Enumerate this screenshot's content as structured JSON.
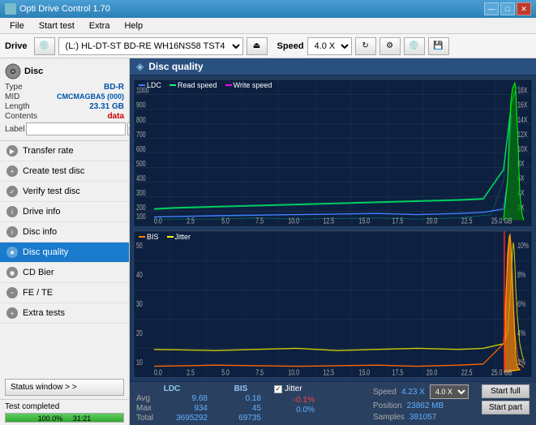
{
  "titleBar": {
    "title": "Opti Drive Control 1.70",
    "minimizeBtn": "—",
    "maximizeBtn": "□",
    "closeBtn": "✕"
  },
  "menuBar": {
    "items": [
      "File",
      "Start test",
      "Extra",
      "Help"
    ]
  },
  "driveToolbar": {
    "driveLabel": "Drive",
    "driveValue": "(L:)  HL-DT-ST BD-RE  WH16NS58 TST4",
    "speedLabel": "Speed",
    "speedValue": "4.0 X"
  },
  "sidebar": {
    "discSection": {
      "title": "Disc",
      "typeLabel": "Type",
      "typeValue": "BD-R",
      "midLabel": "MID",
      "midValue": "CMCMAGBA5 (000)",
      "lengthLabel": "Length",
      "lengthValue": "23.31 GB",
      "contentsLabel": "Contents",
      "contentsValue": "data",
      "labelLabel": "Label",
      "labelPlaceholder": ""
    },
    "navItems": [
      {
        "id": "transfer-rate",
        "label": "Transfer rate"
      },
      {
        "id": "create-test-disc",
        "label": "Create test disc"
      },
      {
        "id": "verify-test-disc",
        "label": "Verify test disc"
      },
      {
        "id": "drive-info",
        "label": "Drive info"
      },
      {
        "id": "disc-info",
        "label": "Disc info"
      },
      {
        "id": "disc-quality",
        "label": "Disc quality",
        "active": true
      },
      {
        "id": "cd-bier",
        "label": "CD Bier"
      },
      {
        "id": "fe-te",
        "label": "FE / TE"
      },
      {
        "id": "extra-tests",
        "label": "Extra tests"
      }
    ],
    "statusWindowBtn": "Status window > >",
    "statusText": "Test completed",
    "progressValue": "100.0%",
    "timeValue": "31:21"
  },
  "contentArea": {
    "title": "Disc quality",
    "chart1": {
      "legend": [
        {
          "label": "LDC",
          "color": "#4080ff"
        },
        {
          "label": "Read speed",
          "color": "#00ff80"
        },
        {
          "label": "Write speed",
          "color": "#ff00ff"
        }
      ],
      "yAxisMax": 1000,
      "yLabels": [
        "1000",
        "900",
        "800",
        "700",
        "600",
        "500",
        "400",
        "300",
        "200",
        "100"
      ],
      "yRight": [
        "18X",
        "16X",
        "14X",
        "12X",
        "10X",
        "8X",
        "6X",
        "4X",
        "2X"
      ],
      "xLabels": [
        "0.0",
        "2.5",
        "5.0",
        "7.5",
        "10.0",
        "12.5",
        "15.0",
        "17.5",
        "20.0",
        "22.5",
        "25.0 GB"
      ]
    },
    "chart2": {
      "legend": [
        {
          "label": "BIS",
          "color": "#ff8000"
        },
        {
          "label": "Jitter",
          "color": "#ffff00"
        }
      ],
      "yAxisMax": 50,
      "yLabels": [
        "50",
        "40",
        "30",
        "20",
        "10"
      ],
      "yRight": [
        "10%",
        "8%",
        "6%",
        "4%",
        "2%"
      ],
      "xLabels": [
        "0.0",
        "2.5",
        "5.0",
        "7.5",
        "10.0",
        "12.5",
        "15.0",
        "17.5",
        "20.0",
        "22.5",
        "25.0 GB"
      ]
    },
    "statsBar": {
      "columns": [
        {
          "header": "LDC",
          "rows": [
            {
              "label": "Avg",
              "value": "9.68"
            },
            {
              "label": "Max",
              "value": "934"
            },
            {
              "label": "Total",
              "value": "3695292"
            }
          ]
        },
        {
          "header": "BIS",
          "rows": [
            {
              "label": "",
              "value": "0.18"
            },
            {
              "label": "",
              "value": "45"
            },
            {
              "label": "",
              "value": "69735"
            }
          ]
        }
      ],
      "jitterLabel": "Jitter",
      "jitterRows": [
        {
          "label": "",
          "value": "-0.1%"
        },
        {
          "label": "",
          "value": "0.0%"
        }
      ],
      "speedLabel": "Speed",
      "speedValue": "4.23 X",
      "speedSelect": "4.0 X",
      "positionLabel": "Position",
      "positionValue": "23862 MB",
      "samplesLabel": "Samples",
      "samplesValue": "381057",
      "startFullBtn": "Start full",
      "startPartBtn": "Start part"
    }
  }
}
